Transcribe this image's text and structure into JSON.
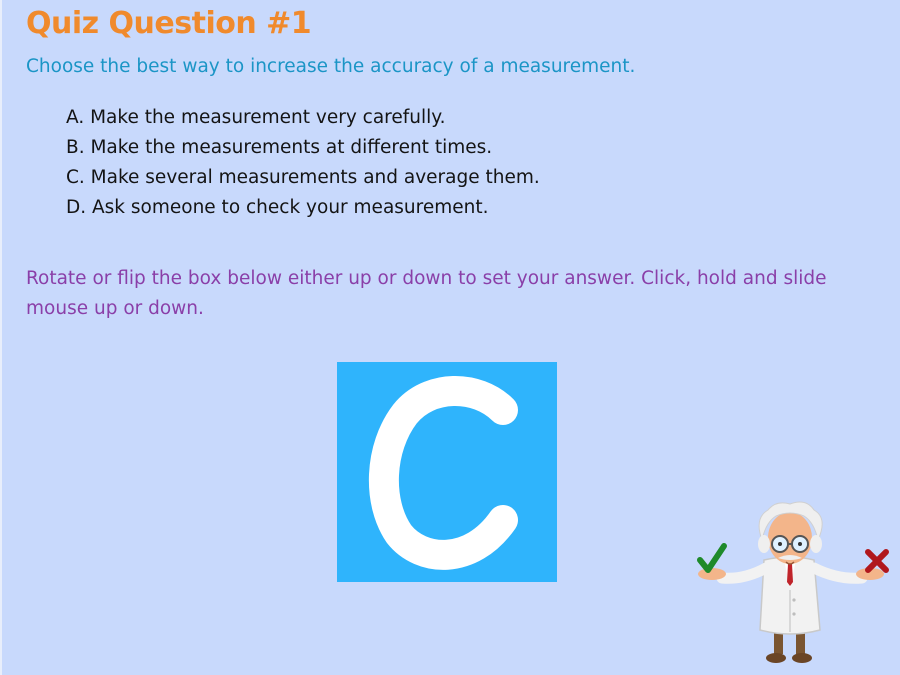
{
  "quiz": {
    "title": "Quiz Question #1",
    "question": "Choose the best way to increase the accuracy of a measurement.",
    "options": [
      "A. Make the measurement very carefully.",
      "B. Make the measurements at different times.",
      "C. Make several measurements and average them.",
      "D. Ask someone to check your measurement."
    ],
    "instruction": "Rotate or flip the box below either up or down to set your answer. Click, hold and slide mouse up or down.",
    "selected_answer": "C"
  },
  "mascot": {
    "icon": "scientist-mascot",
    "correct_icon": "checkmark-icon",
    "incorrect_icon": "x-mark-icon",
    "colors": {
      "check": "#1e8a2a",
      "cross": "#b0171d"
    }
  },
  "colors": {
    "background": "#c8d9fc",
    "title": "#f08a2c",
    "question": "#1b95c6",
    "instruction": "#8a3fa8",
    "answer_box": "#2fb4fc"
  }
}
